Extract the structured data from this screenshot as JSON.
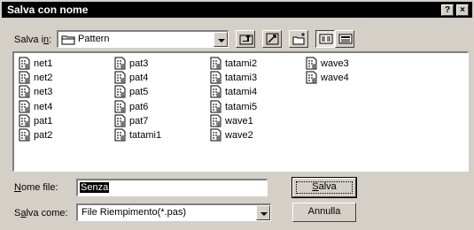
{
  "window": {
    "title": "Salva con nome",
    "help_label": "?",
    "close_label": "×"
  },
  "save_in": {
    "label_pre": "Salva i",
    "label_key": "n",
    "label_post": ":",
    "folder": "Pattern"
  },
  "toolbar": {
    "icons": [
      "up-one-level-icon",
      "desktop-icon",
      "new-folder-icon",
      "list-view-icon",
      "details-view-icon"
    ],
    "active_view": "list"
  },
  "files": [
    "net1",
    "net2",
    "net3",
    "net4",
    "pat1",
    "pat2",
    "pat3",
    "pat4",
    "pat5",
    "pat6",
    "pat7",
    "tatami1",
    "tatami2",
    "tatami3",
    "tatami4",
    "tatami5",
    "wave1",
    "wave2",
    "wave3",
    "wave4"
  ],
  "filename": {
    "label_key": "N",
    "label_rest": "ome file:",
    "value": "Senza"
  },
  "filetype": {
    "label_pre": "S",
    "label_key": "a",
    "label_post": "lva come:",
    "value": "File Riempimento(*.pas)"
  },
  "buttons": {
    "save_key": "S",
    "save_rest": "alva",
    "cancel": "Annulla"
  }
}
